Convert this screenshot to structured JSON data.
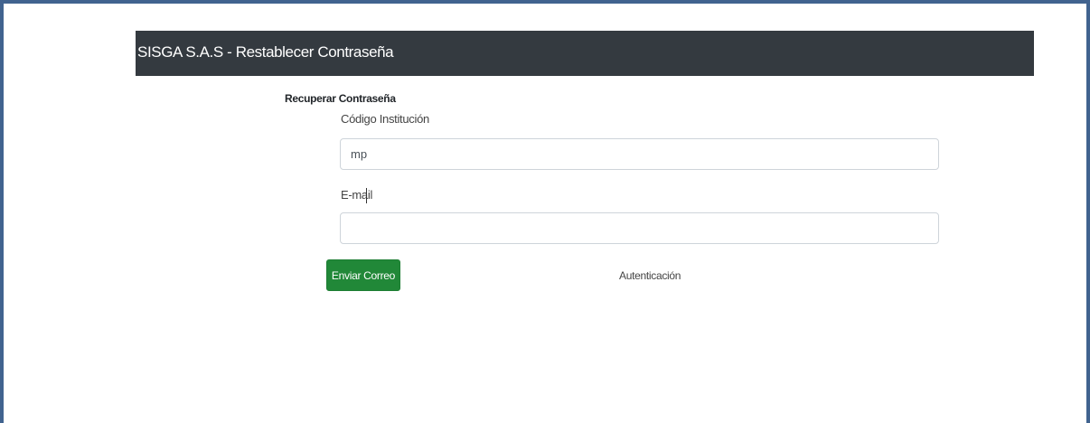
{
  "header": {
    "title": "SISGA S.A.S - Restablecer Contraseña"
  },
  "form": {
    "title": "Recuperar Contraseña",
    "codigo_label": "Código Institución",
    "codigo_value": "mp",
    "email_label": "E-mail",
    "email_value": "",
    "submit_label": "Enviar Correo",
    "auth_link_label": "Autenticación"
  },
  "colors": {
    "navbar_bg": "#343a40",
    "button_bg": "#218838",
    "frame_border": "#41638f"
  }
}
